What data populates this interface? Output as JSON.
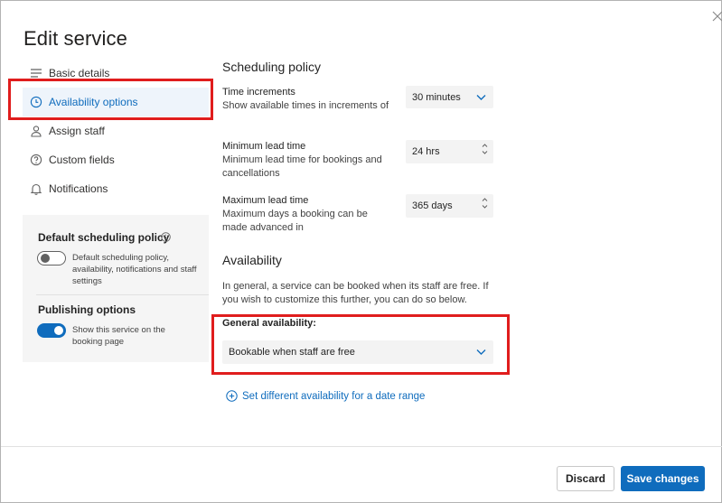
{
  "dialog": {
    "title": "Edit service",
    "close_icon": "close-icon"
  },
  "nav": {
    "items": [
      {
        "label": "Basic details",
        "icon": "lines-icon"
      },
      {
        "label": "Availability options",
        "icon": "clock-icon",
        "active": true
      },
      {
        "label": "Assign staff",
        "icon": "person-icon"
      },
      {
        "label": "Custom fields",
        "icon": "question-icon"
      },
      {
        "label": "Notifications",
        "icon": "bell-icon"
      }
    ]
  },
  "policy_card": {
    "default_title": "Default scheduling policy",
    "default_toggle_desc": "Default scheduling policy, availability, notifications and staff settings",
    "default_toggle_on": false,
    "publishing_title": "Publishing options",
    "publishing_toggle_desc": "Show this service on the booking page",
    "publishing_toggle_on": true
  },
  "scheduling": {
    "title": "Scheduling policy",
    "time_increments": {
      "label": "Time increments",
      "desc": "Show available times in increments of",
      "value": "30 minutes"
    },
    "min_lead": {
      "label": "Minimum lead time",
      "desc": "Minimum lead time for bookings and cancellations",
      "value": "24 hrs"
    },
    "max_lead": {
      "label": "Maximum lead time",
      "desc": "Maximum days a booking can be made advanced in",
      "value": "365 days"
    }
  },
  "availability": {
    "title": "Availability",
    "desc": "In general, a service can be booked when its staff are free. If you wish to customize this further, you can do so below.",
    "general_label": "General availability:",
    "general_value": "Bookable when staff are free",
    "date_range_link": "Set different availability for a date range"
  },
  "footer": {
    "discard_label": "Discard",
    "save_label": "Save changes"
  },
  "colors": {
    "accent": "#0f6cbd",
    "highlight_box": "#e01d1d"
  }
}
